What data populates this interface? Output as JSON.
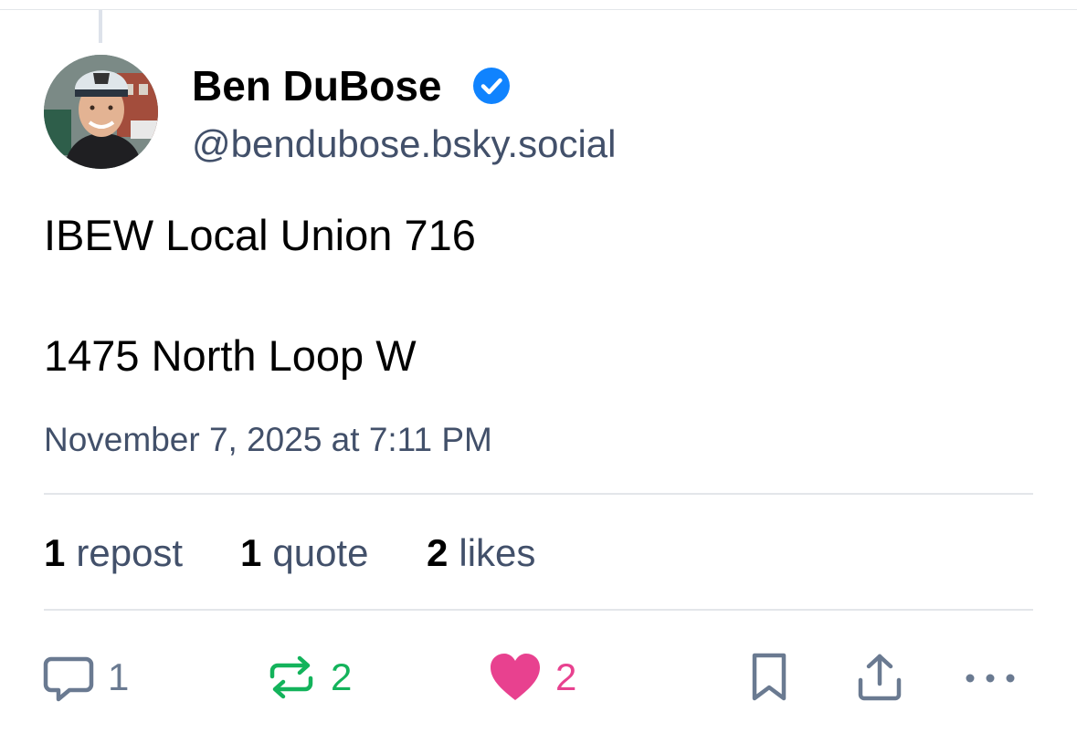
{
  "author": {
    "display_name": "Ben DuBose",
    "handle": "@bendubose.bsky.social",
    "verified": true,
    "avatar_icon": "avatar-photo"
  },
  "post": {
    "lines": [
      "IBEW Local Union 716",
      "1475 North Loop W"
    ],
    "timestamp": "November 7, 2025 at 7:11 PM"
  },
  "stats": [
    {
      "count": "1",
      "label": "repost"
    },
    {
      "count": "1",
      "label": "quote"
    },
    {
      "count": "2",
      "label": "likes"
    }
  ],
  "actions": {
    "reply": {
      "icon": "reply-bubble-icon",
      "count": "1"
    },
    "repost": {
      "icon": "repost-icon",
      "count": "2"
    },
    "like": {
      "icon": "heart-icon",
      "count": "2"
    },
    "bookmark": {
      "icon": "bookmark-icon"
    },
    "share": {
      "icon": "share-icon"
    },
    "more": {
      "icon": "more-dots-icon"
    }
  },
  "colors": {
    "accent_blue": "#1083fe",
    "muted_text": "#42506a",
    "repost_green": "#13b35b",
    "like_pink": "#e8418f"
  }
}
